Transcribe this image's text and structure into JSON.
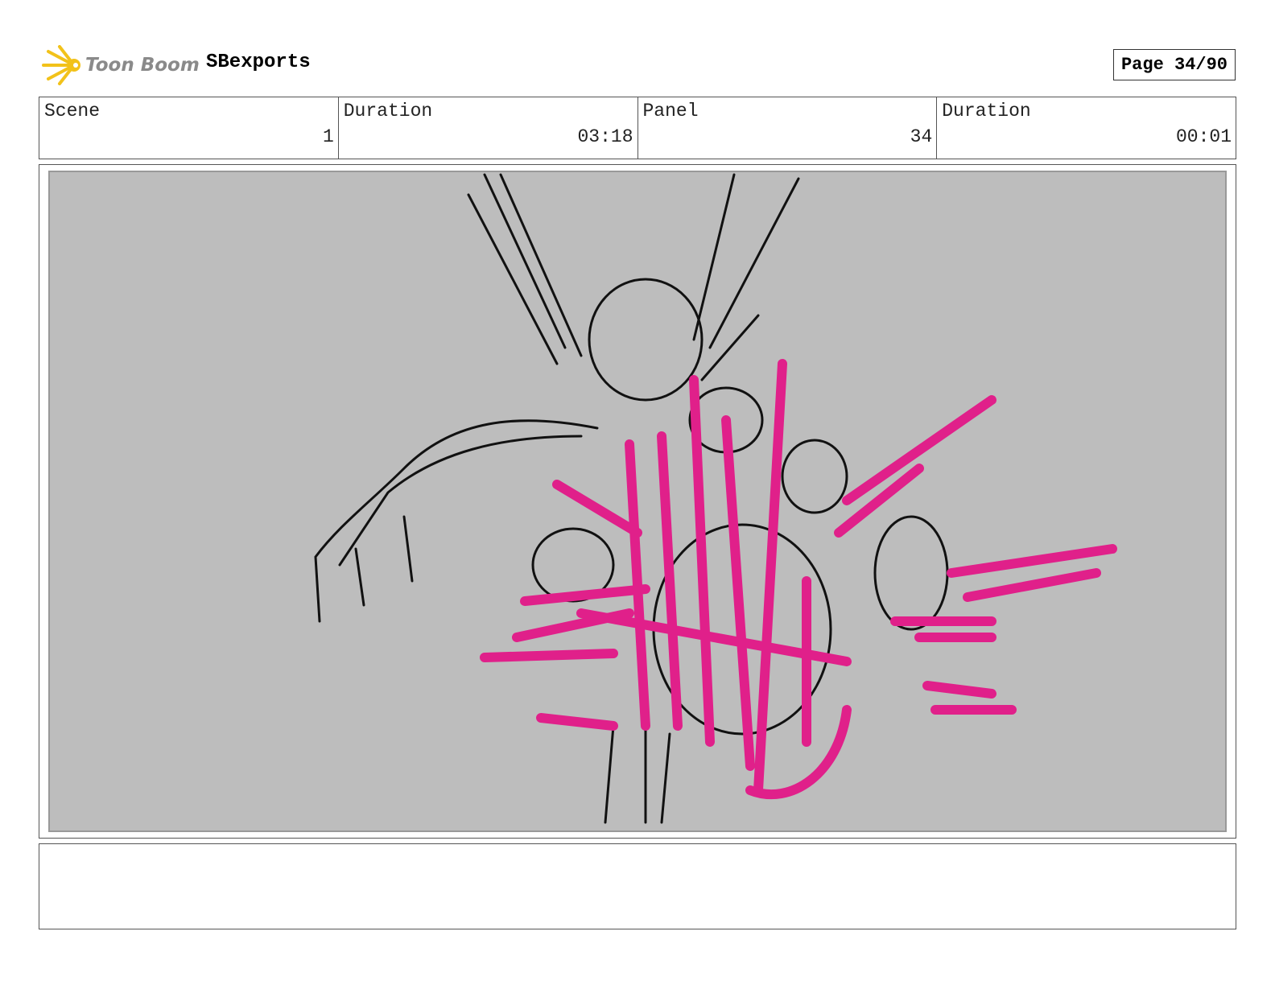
{
  "header": {
    "logo_text": "Toon Boom",
    "project": "SBexports",
    "page": "Page 34/90"
  },
  "info": {
    "scene_label": "Scene",
    "scene": "1",
    "scene_duration_label": "Duration",
    "scene_duration": "03:18",
    "panel_label": "Panel",
    "panel": "34",
    "panel_duration_label": "Duration",
    "panel_duration": "00:01"
  },
  "colors": {
    "accent": "#e0208a",
    "sketch_bg": "#bdbdbd",
    "logo": "#f2c21a"
  }
}
